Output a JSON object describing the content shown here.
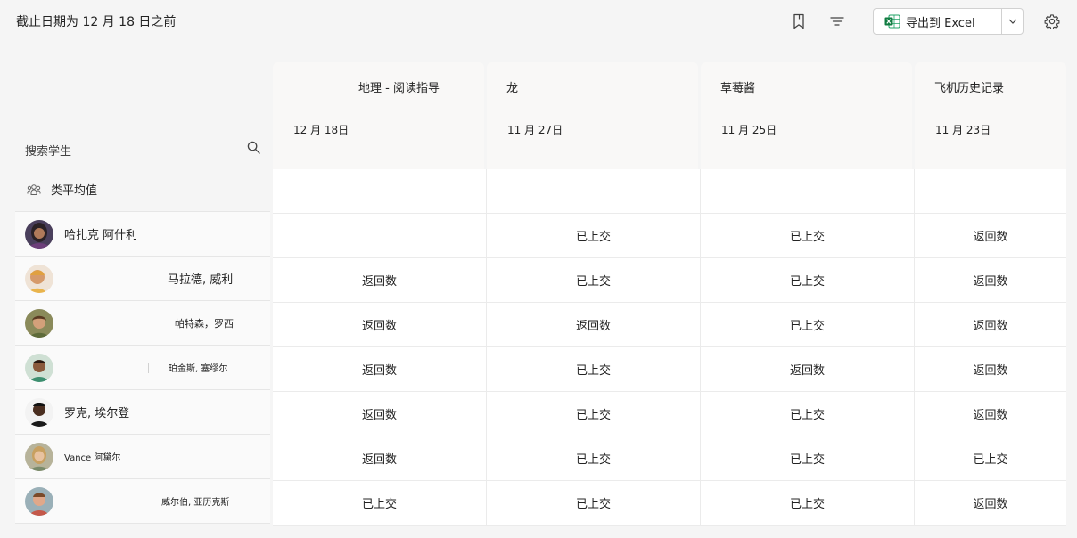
{
  "header": {
    "title": "截止日期为 12 月 18 日之前",
    "export_label": "导出到 Excel",
    "icons": [
      "bookmark-icon",
      "filter-icon",
      "excel-icon",
      "chevron-down-icon",
      "gear-icon"
    ]
  },
  "search": {
    "label": "搜索学生"
  },
  "average": {
    "label": "类平均值"
  },
  "assignments": [
    {
      "title": "地理 - 阅读指导",
      "date": "12 月 18日"
    },
    {
      "title": "龙",
      "date": "11 月 27日"
    },
    {
      "title": "草莓酱",
      "date": "11 月 25日"
    },
    {
      "title": "飞机历史记录",
      "date": "11 月 23日"
    }
  ],
  "students": [
    {
      "name": "哈扎克 阿什利",
      "statuses": [
        "",
        "已上交",
        "已上交",
        "返回数"
      ]
    },
    {
      "name": "马拉德, 威利",
      "statuses": [
        "返回数",
        "已上交",
        "已上交",
        "返回数"
      ]
    },
    {
      "name": "帕特森，罗西",
      "statuses": [
        "返回数",
        "返回数",
        "已上交",
        "返回数"
      ]
    },
    {
      "name": "珀金斯, 塞缪尔",
      "statuses": [
        "返回数",
        "已上交",
        "返回数",
        "返回数"
      ]
    },
    {
      "name": "罗克, 埃尔登",
      "statuses": [
        "返回数",
        "已上交",
        "已上交",
        "返回数"
      ]
    },
    {
      "name": "Vance 阿黛尔",
      "statuses": [
        "返回数",
        "已上交",
        "已上交",
        "已上交"
      ]
    },
    {
      "name": "威尔伯, 亚历克斯",
      "statuses": [
        "已上交",
        "已上交",
        "已上交",
        "返回数"
      ]
    }
  ],
  "colors": {
    "excel_green": "#107c41",
    "background": "#f5f5f5"
  }
}
